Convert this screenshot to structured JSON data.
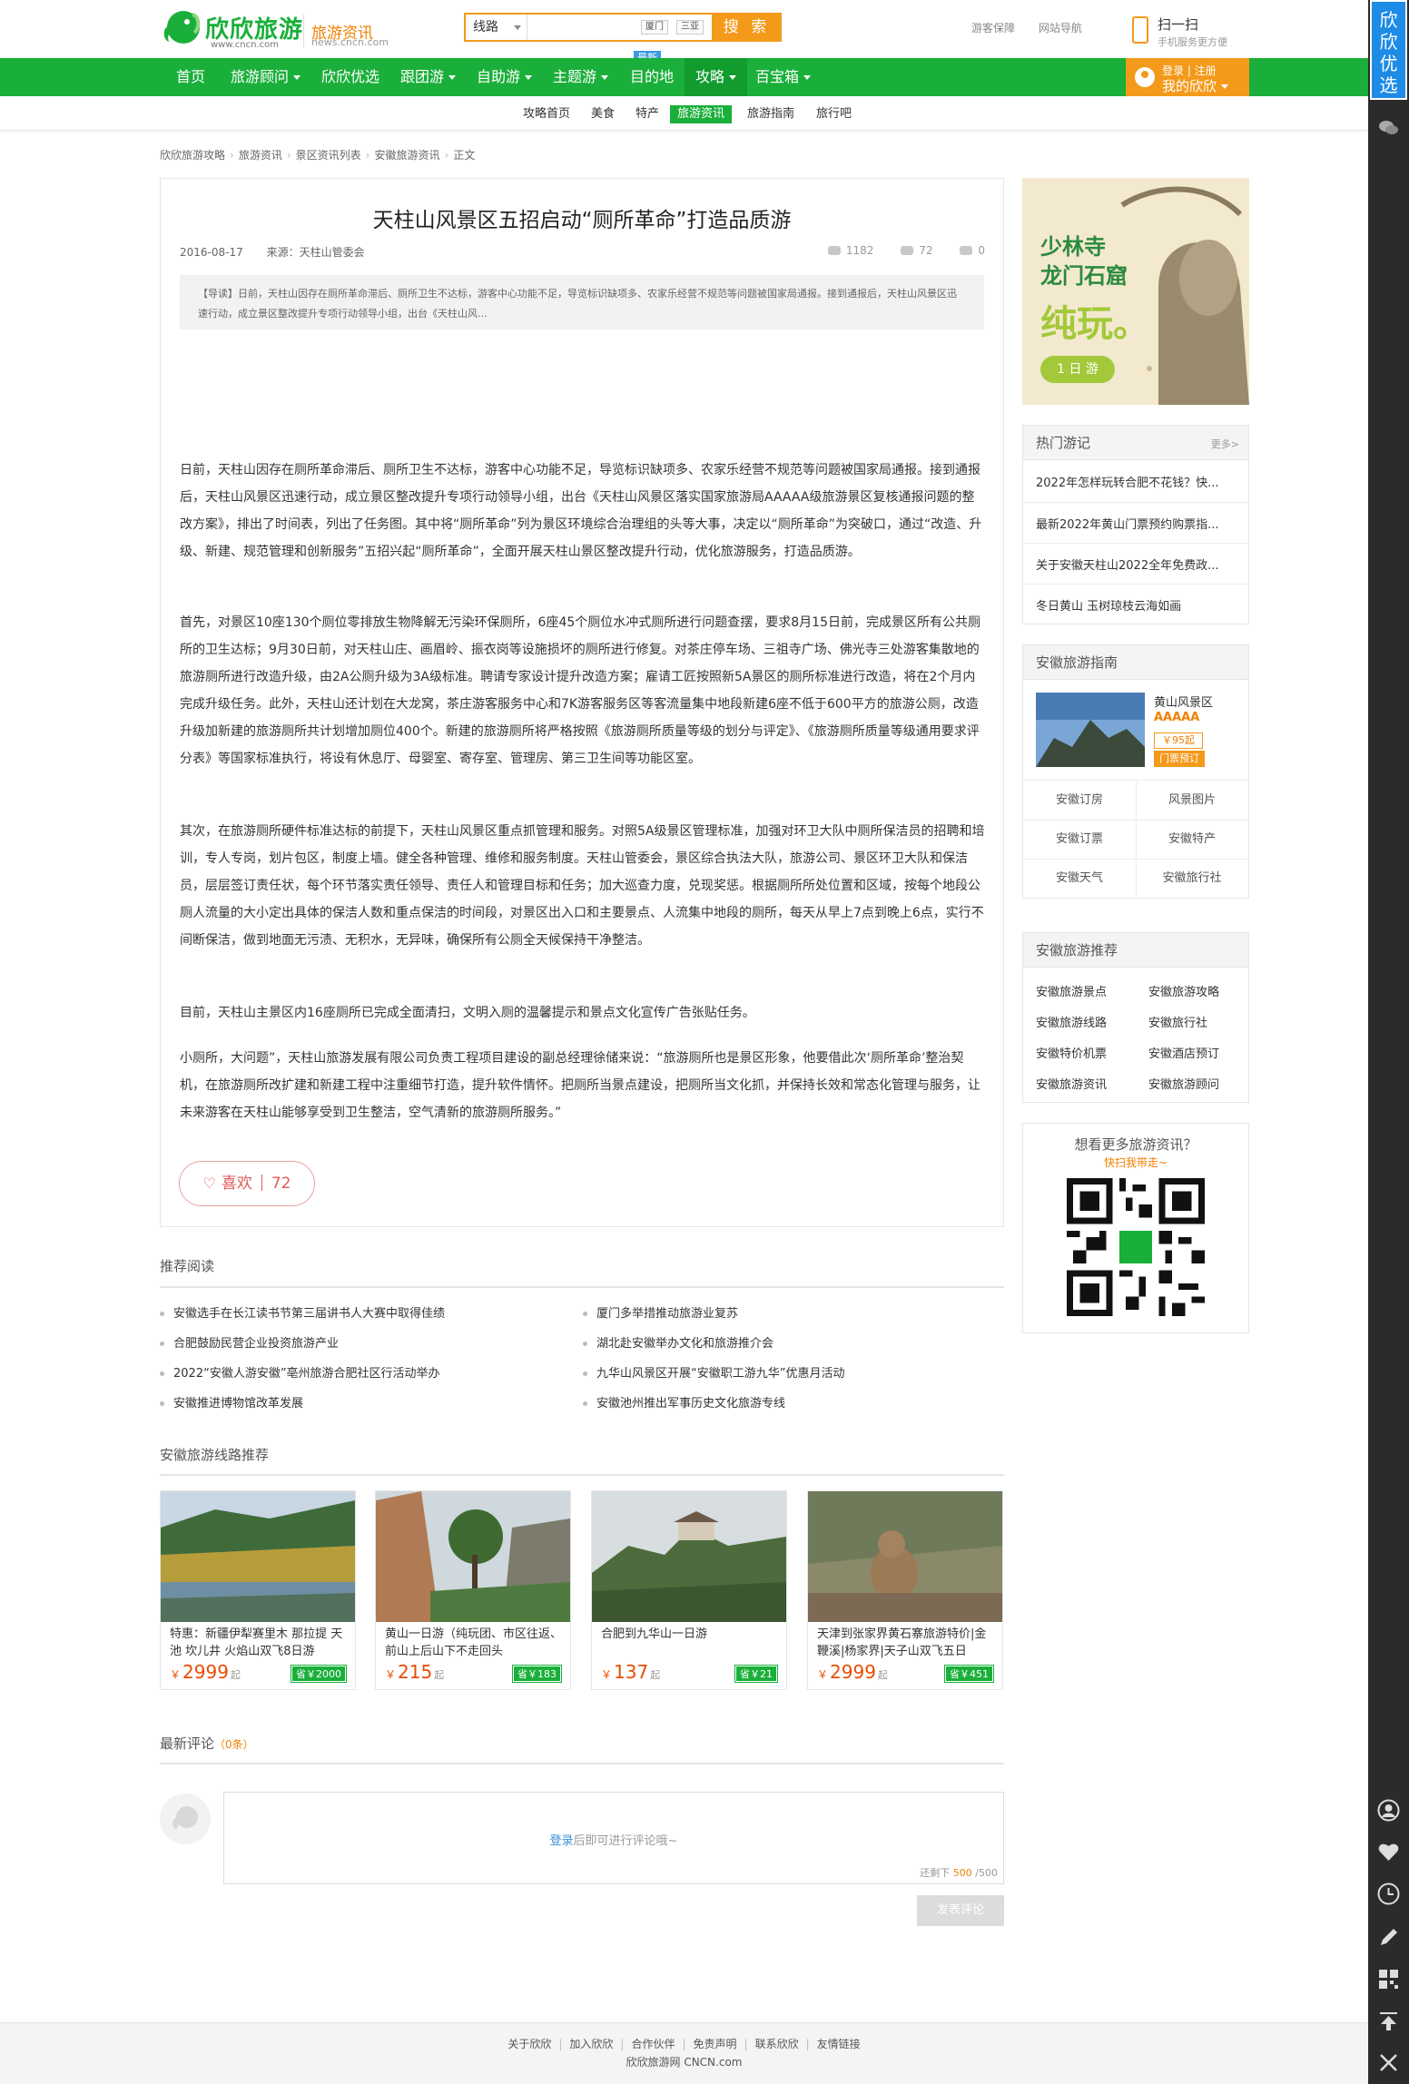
{
  "header": {
    "brand": "欣欣旅游",
    "brand_url": "www.cncn.com",
    "channel": "旅游资讯",
    "channel_url": "news.cncn.com",
    "search_select": "线路",
    "search_hot": [
      "厦门",
      "三亚"
    ],
    "search_button": "搜 索",
    "search_badge": "最新",
    "top_links": [
      "游客保障",
      "网站导航"
    ],
    "scan_title": "扫一扫",
    "scan_sub": "手机服务更方便"
  },
  "nav": {
    "items": [
      "首页",
      "旅游顾问",
      "欣欣优选",
      "跟团游",
      "自助游",
      "主题游",
      "目的地",
      "攻略",
      "百宝箱"
    ],
    "login_line1": "登录 | 注册",
    "login_line2": "我的欣欣"
  },
  "subnav": [
    "攻略首页",
    "美食",
    "特产",
    "旅游资讯",
    "旅游指南",
    "旅行吧"
  ],
  "breadcrumb": [
    "欣欣旅游攻略",
    "旅游资讯",
    "景区资讯列表",
    "安徽旅游资讯",
    "正文"
  ],
  "article": {
    "title": "天柱山风景区五招启动“厕所革命”打造品质游",
    "date": "2016-08-17",
    "source": "来源：天柱山管委会",
    "views": "1182",
    "likes": "72",
    "comments": "0",
    "summary": "【导读】日前，天柱山因存在厕所革命滞后、厕所卫生不达标，游客中心功能不足，导览标识缺项多、农家乐经营不规范等问题被国家局通报。接到通报后，天柱山风景区迅速行动，成立景区整改提升专项行动领导小组，出台《天柱山风...",
    "paragraphs": [
      "日前，天柱山因存在厕所革命滞后、厕所卫生不达标，游客中心功能不足，导览标识缺项多、农家乐经营不规范等问题被国家局通报。接到通报后，天柱山风景区迅速行动，成立景区整改提升专项行动领导小组，出台《天柱山风景区落实国家旅游局AAAAA级旅游景区复核通报问题的整改方案》，排出了时间表，列出了任务图。其中将“厕所革命”列为景区环境综合治理组的头等大事，决定以“厕所革命”为突破口，通过“改造、升级、新建、规范管理和创新服务”五招兴起“厕所革命”，全面开展天柱山景区整改提升行动，优化旅游服务，打造品质游。",
      "首先，对景区10座130个厕位零排放生物降解无污染环保厕所，6座45个厕位水冲式厕所进行问题查摆，要求8月15日前，完成景区所有公共厕所的卫生达标；9月30日前，对天柱山庄、画眉岭、振衣岗等设施损坏的厕所进行修复。对茶庄停车场、三祖寺广场、佛光寺三处游客集散地的旅游厕所进行改造升级，由2A公厕升级为3A级标准。聘请专家设计提升改造方案；雇请工匠按照新5A景区的厕所标准进行改造，将在2个月内完成升级任务。此外，天柱山还计划在大龙窝，茶庄游客服务中心和7K游客服务区等客流量集中地段新建6座不低于600平方的旅游公厕，改造升级加新建的旅游厕所共计划增加厕位400个。新建的旅游厕所将严格按照《旅游厕所质量等级的划分与评定》、《旅游厕所质量等级通用要求评分表》等国家标准执行，将设有休息厅、母婴室、寄存室、管理房、第三卫生间等功能区室。",
      "其次，在旅游厕所硬件标准达标的前提下，天柱山风景区重点抓管理和服务。对照5A级景区管理标准，加强对环卫大队中厕所保洁员的招聘和培训，专人专岗，划片包区，制度上墙。健全各种管理、维修和服务制度。天柱山管委会，景区综合执法大队，旅游公司、景区环卫大队和保洁员，层层签订责任状，每个环节落实责任领导、责任人和管理目标和任务；加大巡查力度，兑现奖惩。根据厕所所处位置和区域，按每个地段公厕人流量的大小定出具体的保洁人数和重点保洁的时间段，对景区出入口和主要景点、人流集中地段的厕所，每天从早上7点到晚上6点，实行不间断保洁，做到地面无污渍、无积水，无异味，确保所有公厕全天候保持干净整洁。",
      "目前，天柱山主景区内16座厕所已完成全面清扫，文明入厕的温馨提示和景点文化宣传广告张贴任务。",
      "小厕所，大问题”，天柱山旅游发展有限公司负责工程项目建设的副总经理徐储来说：“旅游厕所也是景区形象，他要借此次‘厕所革命’整治契机，在旅游厕所改扩建和新建工程中注重细节打造，提升软件情怀。把厕所当景点建设，把厕所当文化抓，并保持长效和常态化管理与服务，让未来游客在天柱山能够享受到卫生整洁，空气清新的旅游厕所服务。”"
    ],
    "like_label": "喜欢",
    "like_count": "72"
  },
  "recommend": {
    "title": "推荐阅读",
    "left": [
      "安徽选手在长江读书节第三届讲书人大赛中取得佳绩",
      "合肥鼓励民营企业投资旅游产业",
      "2022“安徽人游安徽”亳州旅游合肥社区行活动举办",
      "安徽推进博物馆改革发展"
    ],
    "right": [
      "厦门多举措推动旅游业复苏",
      "湖北赴安徽举办文化和旅游推介会",
      "九华山风景区开展“安徽职工游九华”优惠月活动",
      "安徽池州推出军事历史文化旅游专线"
    ]
  },
  "routes": {
    "title": "安徽旅游线路推荐",
    "items": [
      {
        "name": "特惠：新疆伊犁赛里木 那拉提 天池 坎儿井 火焰山双飞8日游",
        "price": "2999",
        "save": "省￥2000"
      },
      {
        "name": "黄山一日游（纯玩团、市区往返、前山上后山下不走回头",
        "price": "215",
        "save": "省￥183"
      },
      {
        "name": "合肥到九华山一日游",
        "price": "137",
        "save": "省￥21"
      },
      {
        "name": "天津到张家界黄石寨旅游特价|金鞭溪|杨家界|天子山双飞五日",
        "price": "2999",
        "save": "省￥451"
      }
    ],
    "yuan": "￥",
    "qi": "起"
  },
  "comments": {
    "title": "最新评论",
    "count": "（0条）",
    "login_link": "登录",
    "login_hint": "后即可进行评论哦~",
    "remaining_label": "还剩下",
    "remaining": "500",
    "max": "/500",
    "post_button": "发表评论"
  },
  "footer": {
    "links": [
      "关于欣欣",
      "加入欣欣",
      "合作伙伴",
      "免责声明",
      "联系欣欣",
      "友情链接"
    ],
    "copyright": "欣欣旅游网 CNCN.com"
  },
  "sidebar": {
    "ad_line1": "少林寺",
    "ad_line2": "龙门石窟",
    "ad_line3": "纯玩。",
    "ad_line4": "1 日 游",
    "hot_title": "热门游记",
    "hot_more": "更多>",
    "hot_items": [
      "2022年怎样玩转合肥不花钱？快...",
      "最新2022年黄山门票预约购票指...",
      "关于安徽天柱山2022全年免费政...",
      "冬日黄山 玉树琼枝云海如画"
    ],
    "guide_title": "安徽旅游指南",
    "guide_spot": "黄山风景区",
    "guide_rating": "AAAAA",
    "guide_price": "￥95起",
    "guide_ticket": "门票预订",
    "guide_cells": [
      "安徽订房",
      "风景图片",
      "安徽订票",
      "安徽特产",
      "安徽天气",
      "安徽旅行社"
    ],
    "rec_title": "安徽旅游推荐",
    "rec_items": [
      "安徽旅游景点",
      "安徽旅游攻略",
      "安徽旅游线路",
      "安徽旅行社",
      "安徽特价机票",
      "安徽酒店预订",
      "安徽旅游资讯",
      "安徽旅游顾问"
    ],
    "qr_title": "想看更多旅游资讯？",
    "qr_sub": "快扫我带走~"
  },
  "toolbar": {
    "pick": "欣欣优选"
  },
  "colors": {
    "brand_green": "#1aaf3a",
    "accent_orange": "#f39a1a",
    "price_red": "#e94c00",
    "link_blue": "#3a8fd9"
  }
}
